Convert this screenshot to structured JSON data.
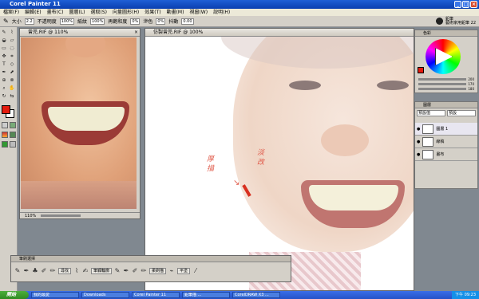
{
  "app": {
    "title": "Corel Painter 11"
  },
  "menu": [
    "檔案(F)",
    "編輯(E)",
    "畫布(C)",
    "圖層(L)",
    "選取(S)",
    "向量圖形(H)",
    "效果(T)",
    "動畫(M)",
    "視窗(W)",
    "說明(H)"
  ],
  "propbar": {
    "size_label": "大小",
    "size_value": "2.2",
    "opacity_label": "不透明度",
    "opacity_value": "100%",
    "grain_label": "紙紋",
    "grain_value": "100%",
    "resat_label": "再飽和度",
    "resat_value": "0%",
    "bleed_label": "滲色",
    "bleed_value": "0%",
    "jitter_label": "抖動",
    "jitter_value": "0.00"
  },
  "brush_info": {
    "category": "鉛筆",
    "variant": "藝術家用鉛筆 22"
  },
  "doc_small": {
    "title": "曾芫.RIF @ 110%",
    "zoom": "110%"
  },
  "doc_main": {
    "title": "仿製曾芫.RIF @ 100%"
  },
  "annotations": {
    "left": "厚描",
    "right": "淡改"
  },
  "color_panel": {
    "title": "色彩",
    "values": [
      "200",
      "170",
      "180"
    ]
  },
  "layers_panel": {
    "title": "圖層",
    "blend": "預設值",
    "composite": "預設",
    "layers": [
      {
        "name": "圖層 1"
      },
      {
        "name": "線稿"
      },
      {
        "name": "畫布"
      }
    ]
  },
  "brush_panel": {
    "title": "筆刷選擇",
    "buttons": [
      "尋找",
      "筆觸輪廓",
      "柔刷描",
      "平塗"
    ]
  },
  "taskbar": {
    "start": "開始",
    "tasks": [
      "我的最愛",
      "Downloads",
      "Corel Painter 11",
      "鉛筆描 ...",
      "CorelDRAW X3 ..."
    ],
    "clock": "下午 09:23"
  }
}
